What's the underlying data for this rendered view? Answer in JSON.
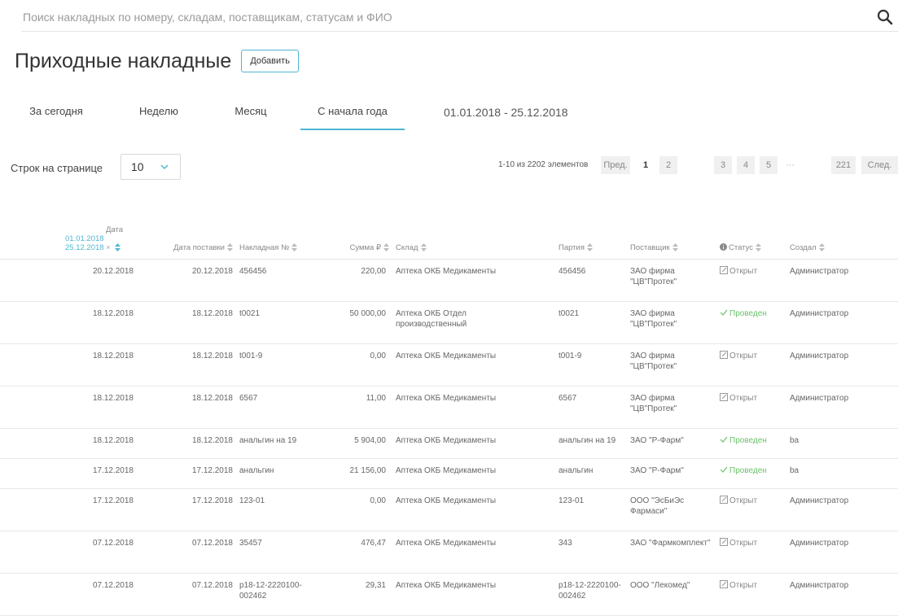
{
  "search": {
    "placeholder": "Поиск накладных по номеру, складам, поставщикам, статусам и ФИО"
  },
  "header": {
    "title": "Приходные накладные",
    "add_label": "Добавить"
  },
  "tabs": [
    {
      "label": "За сегодня"
    },
    {
      "label": "Неделю"
    },
    {
      "label": "Месяц"
    },
    {
      "label": "С начала года",
      "active": true
    }
  ],
  "date_range": "01.01.2018 - 25.12.2018",
  "rows_per_page": {
    "label": "Строк на странице",
    "value": "10"
  },
  "pager": {
    "count": "1-10 из 2202 элементов",
    "prev": "Пред.",
    "pages": [
      "1",
      "2",
      "3",
      "4",
      "5"
    ],
    "ellipsis": "···",
    "last": "221",
    "next": "След."
  },
  "table": {
    "headers": {
      "date": "Дата",
      "date_from": "01.01.2018",
      "date_to": "25.12.2018",
      "delivery_date": "Дата поставки",
      "invoice": "Накладная №",
      "sum": "Сумма ₽",
      "warehouse": "Склад",
      "batch": "Партия",
      "supplier": "Поставщик",
      "status": "Статус",
      "author": "Создал"
    },
    "rows": [
      {
        "date": "20.12.2018",
        "delivery": "20.12.2018",
        "invoice": "456456",
        "sum": "220,00",
        "warehouse": "Аптека ОКБ Медикаменты",
        "batch": "456456",
        "supplier": "ЗАО фирма \"ЦВ\"Протек\"",
        "status": "Открыт",
        "author": "Администратор"
      },
      {
        "date": "18.12.2018",
        "delivery": "18.12.2018",
        "invoice": "t0021",
        "sum": "50 000,00",
        "warehouse": "Аптека ОКБ Отдел производственный",
        "batch": "t0021",
        "supplier": "ЗАО фирма \"ЦВ\"Протек\"",
        "status": "Проведен",
        "author": "Администратор"
      },
      {
        "date": "18.12.2018",
        "delivery": "18.12.2018",
        "invoice": "t001-9",
        "sum": "0,00",
        "warehouse": "Аптека ОКБ Медикаменты",
        "batch": "t001-9",
        "supplier": "ЗАО фирма \"ЦВ\"Протек\"",
        "status": "Открыт",
        "author": "Администратор"
      },
      {
        "date": "18.12.2018",
        "delivery": "18.12.2018",
        "invoice": "6567",
        "sum": "11,00",
        "warehouse": "Аптека ОКБ Медикаменты",
        "batch": "6567",
        "supplier": "ЗАО фирма \"ЦВ\"Протек\"",
        "status": "Открыт",
        "author": "Администратор"
      },
      {
        "date": "18.12.2018",
        "delivery": "18.12.2018",
        "invoice": "анальгин на 19",
        "sum": "5 904,00",
        "warehouse": "Аптека ОКБ Медикаменты",
        "batch": "анальгин на 19",
        "supplier": "ЗАО \"Р-Фарм\"",
        "status": "Проведен",
        "author": "ba"
      },
      {
        "date": "17.12.2018",
        "delivery": "17.12.2018",
        "invoice": "анальгин",
        "sum": "21 156,00",
        "warehouse": "Аптека ОКБ Медикаменты",
        "batch": "анальгин",
        "supplier": "ЗАО \"Р-Фарм\"",
        "status": "Проведен",
        "author": "ba"
      },
      {
        "date": "17.12.2018",
        "delivery": "17.12.2018",
        "invoice": "123-01",
        "sum": "0,00",
        "warehouse": "Аптека ОКБ Медикаменты",
        "batch": "123-01",
        "supplier": "ООО \"ЭсБиЭс Фармаси\"",
        "status": "Открыт",
        "author": "Администратор"
      },
      {
        "date": "07.12.2018",
        "delivery": "07.12.2018",
        "invoice": "35457",
        "sum": "476,47",
        "warehouse": "Аптека ОКБ Медикаменты",
        "batch": "343",
        "supplier": "ЗАО \"Фармкомплект\"",
        "status": "Открыт",
        "author": "Администратор"
      },
      {
        "date": "07.12.2018",
        "delivery": "07.12.2018",
        "invoice": "p18-12-2220100-002462",
        "sum": "29,31",
        "warehouse": "Аптека ОКБ Медикаменты",
        "batch": "p18-12-2220100-002462",
        "supplier": "ООО \"Лекомед\"",
        "status": "Открыт",
        "author": "Администратор"
      }
    ]
  },
  "colors": {
    "accent": "#4db6d2",
    "success": "#6cc26c"
  },
  "icons": {
    "search": "search-icon",
    "sort": "sort-icon",
    "chevron": "chevron-down-icon",
    "open": "edit-icon",
    "done": "check-icon",
    "info": "info-icon",
    "clear": "close-icon"
  }
}
